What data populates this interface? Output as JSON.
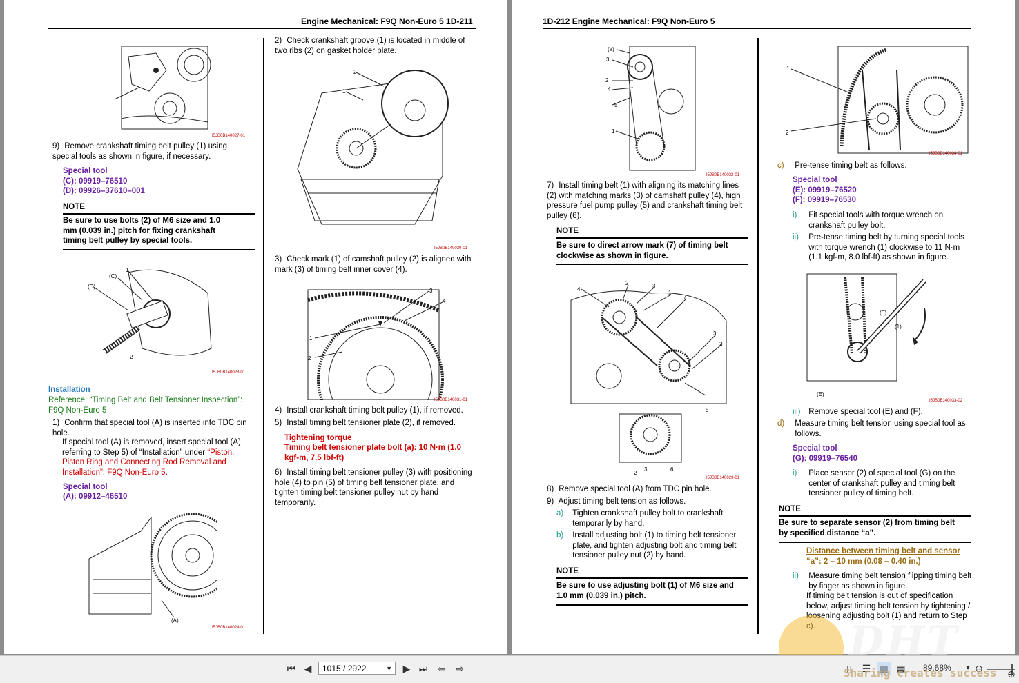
{
  "left_page": {
    "header": "Engine Mechanical: F9Q Non-Euro 5   1D-211",
    "col1": {
      "fig1_caption": "I5JB0B140027-01",
      "step9_num": "9)",
      "step9_text": "Remove crankshaft timing belt pulley (1) using special tools as shown in figure, if necessary.",
      "special_tool_label": "Special tool",
      "tool_c": "(C):  09919–76510",
      "tool_d": "(D):  09926–37610–001",
      "note_label": "NOTE",
      "note_text": "Be sure to use bolts (2) of M6 size and 1.0 mm (0.039 in.) pitch for fixing crankshaft timing belt pulley by special tools.",
      "fig2_caption": "I5JB0B140028-01",
      "installation_heading": "Installation",
      "reference": "Reference: “Timing Belt and Belt Tensioner Inspection”: F9Q Non-Euro 5",
      "step1_num": "1)",
      "step1_text_a": "Confirm that special tool (A) is inserted into TDC pin hole.",
      "step1_text_b": "If special tool (A) is removed, insert special tool (A) referring to Step 5) of “Installation” under ",
      "step1_link": "“Piston, Piston Ring and Connecting Rod Removal and Installation”: F9Q Non-Euro 5",
      "step1_end": ".",
      "special_tool_label2": "Special tool",
      "tool_a": "(A):  09912–46510",
      "fig3_caption": "I5JB0B140024-01"
    },
    "col2": {
      "step2_num": "2)",
      "step2_text": "Check crankshaft groove (1) is located in middle of two ribs (2) on gasket holder plate.",
      "fig4_caption": "I5JB0B140030-01",
      "step3_num": "3)",
      "step3_text": "Check mark (1) of camshaft pulley (2) is aligned with mark (3) of timing belt inner cover (4).",
      "fig5_caption": "I5JB0B140031-01",
      "step4_num": "4)",
      "step4_text": "Install crankshaft timing belt pulley (1), if removed.",
      "step5_num": "5)",
      "step5_text": "Install timing belt tensioner plate (2), if removed.",
      "torque_label": "Tightening torque",
      "torque_text": "Timing belt tensioner plate bolt (a):  10 N·m (1.0 kgf-m, 7.5 lbf-ft)",
      "step6_num": "6)",
      "step6_text": "Install timing belt tensioner pulley (3) with positioning hole (4) to pin (5) of timing belt tensioner plate, and tighten timing belt tensioner pulley nut by hand temporarily."
    }
  },
  "right_page": {
    "header": "1D-212   Engine Mechanical: F9Q Non-Euro 5",
    "col1": {
      "fig6_caption": "I5JB0B140032-01",
      "step7_num": "7)",
      "step7_text": "Install timing belt (1) with aligning its matching lines (2) with matching marks (3) of camshaft pulley (4), high pressure fuel pump pulley (5) and crankshaft timing belt pulley (6).",
      "note_label": "NOTE",
      "note_text": "Be sure to direct arrow mark (7) of timing belt clockwise as shown in figure.",
      "fig7_caption": "I5JB0B140029-01",
      "step8_num": "8)",
      "step8_text": "Remove special tool (A) from TDC pin hole.",
      "step9_num": "9)",
      "step9_text": "Adjust timing belt tension as follows.",
      "sub_a_num": "a)",
      "sub_a_text": "Tighten crankshaft pulley bolt to crankshaft temporarily by hand.",
      "sub_b_num": "b)",
      "sub_b_text": "Install adjusting bolt (1) to timing belt tensioner plate, and tighten adjusting bolt and timing belt tensioner pulley nut (2) by hand.",
      "note2_label": "NOTE",
      "note2_text": "Be sure to use adjusting bolt (1) of M6 size and 1.0 mm (0.039 in.) pitch."
    },
    "col2": {
      "fig8_caption": "I5JB0B140034-01",
      "sub_c_num": "c)",
      "sub_c_text": "Pre-tense timing belt as follows.",
      "special_tool_label": "Special tool",
      "tool_e": "(E):  09919–76520",
      "tool_f": "(F):  09919–76530",
      "i_num": "i)",
      "i_text": "Fit special tools with torque wrench on crankshaft pulley bolt.",
      "ii_num": "ii)",
      "ii_text": "Pre-tense timing belt by turning special tools with torque wrench (1) clockwise to 11 N·m (1.1 kgf-m, 8.0 lbf-ft) as shown in figure.",
      "fig9_caption": "I5JB0B140033-02",
      "iii_num": "iii)",
      "iii_text": "Remove special tool (E) and (F).",
      "sub_d_num": "d)",
      "sub_d_text": "Measure timing belt tension using special tool as follows.",
      "special_tool_label2": "Special tool",
      "tool_g": "(G):  09919–76540",
      "di_num": "i)",
      "di_text": "Place sensor (2) of special tool (G) on the center of crankshaft pulley and timing belt tensioner pulley of timing belt.",
      "note_label": "NOTE",
      "note_text": "Be sure to separate sensor (2) from timing belt by specified distance “a”.",
      "distance_label": "Distance between timing belt and sensor",
      "distance_value": "“a”: 2 – 10 mm (0.08 – 0.40 in.)",
      "dii_num": "ii)",
      "dii_text_a": "Measure timing belt tension flipping timing belt by finger as shown in figure.",
      "dii_text_b": "If timing belt tension is out of specification below, adjust timing belt tension by tightening / loosening adjusting bolt (1) and return to Step c)."
    }
  },
  "toolbar": {
    "page_indicator": "1015 / 2922",
    "zoom": "89.68%"
  },
  "watermark": {
    "text": "DHT",
    "subtitle": "Sharing creates success"
  }
}
